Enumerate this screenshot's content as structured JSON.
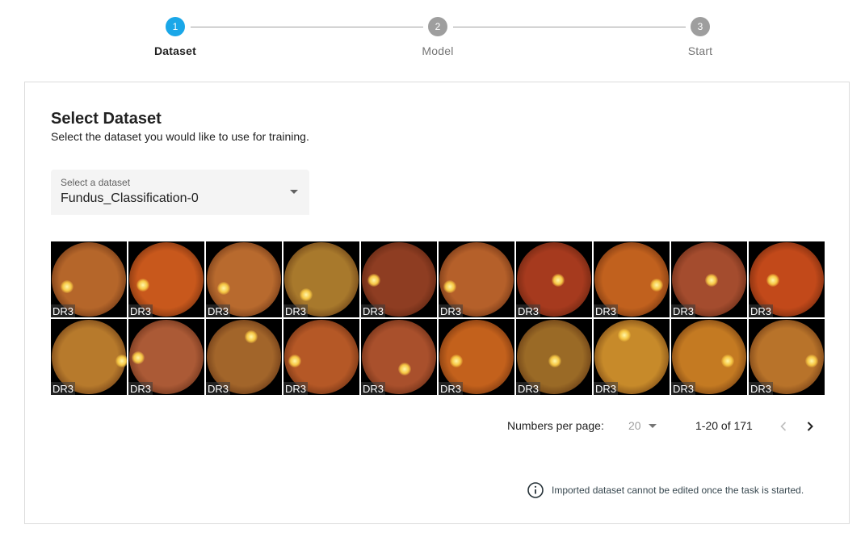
{
  "stepper": {
    "steps": [
      {
        "number": "1",
        "label": "Dataset",
        "active": true
      },
      {
        "number": "2",
        "label": "Model",
        "active": false
      },
      {
        "number": "3",
        "label": "Start",
        "active": false
      }
    ]
  },
  "card": {
    "title": "Select Dataset",
    "subtitle": "Select the dataset you would like to use for training.",
    "dataset_select": {
      "label": "Select a dataset",
      "value": "Fundus_Classification-0"
    }
  },
  "images": [
    {
      "tag": "DR3",
      "tone": "#b5662a"
    },
    {
      "tag": "DR3",
      "tone": "#c8581c"
    },
    {
      "tag": "DR3",
      "tone": "#b86a2e"
    },
    {
      "tag": "DR3",
      "tone": "#a8792c"
    },
    {
      "tag": "DR3",
      "tone": "#8e3d22"
    },
    {
      "tag": "DR3",
      "tone": "#b5602a"
    },
    {
      "tag": "DR3",
      "tone": "#a63a1e"
    },
    {
      "tag": "DR3",
      "tone": "#c1611e"
    },
    {
      "tag": "DR3",
      "tone": "#a44c2e"
    },
    {
      "tag": "DR3",
      "tone": "#c2491a"
    },
    {
      "tag": "DR3",
      "tone": "#b77a2c"
    },
    {
      "tag": "DR3",
      "tone": "#ab5a36"
    },
    {
      "tag": "DR3",
      "tone": "#a2652a"
    },
    {
      "tag": "DR3",
      "tone": "#b55826"
    },
    {
      "tag": "DR3",
      "tone": "#a9502c"
    },
    {
      "tag": "DR3",
      "tone": "#c3611c"
    },
    {
      "tag": "DR3",
      "tone": "#9a6a26"
    },
    {
      "tag": "DR3",
      "tone": "#c78a2a"
    },
    {
      "tag": "DR3",
      "tone": "#c47a22"
    },
    {
      "tag": "DR3",
      "tone": "#b8732a"
    }
  ],
  "pagination": {
    "per_page_label": "Numbers per page:",
    "per_page_value": "20",
    "range_label": "1-20 of 171",
    "prev_icon": "chevron-left-icon",
    "next_icon": "chevron-right-icon"
  },
  "note": {
    "icon": "info-icon",
    "text": "Imported dataset cannot be edited once the task is started."
  },
  "colors": {
    "accent": "#1aa7e8",
    "inactive": "#9e9e9e"
  }
}
